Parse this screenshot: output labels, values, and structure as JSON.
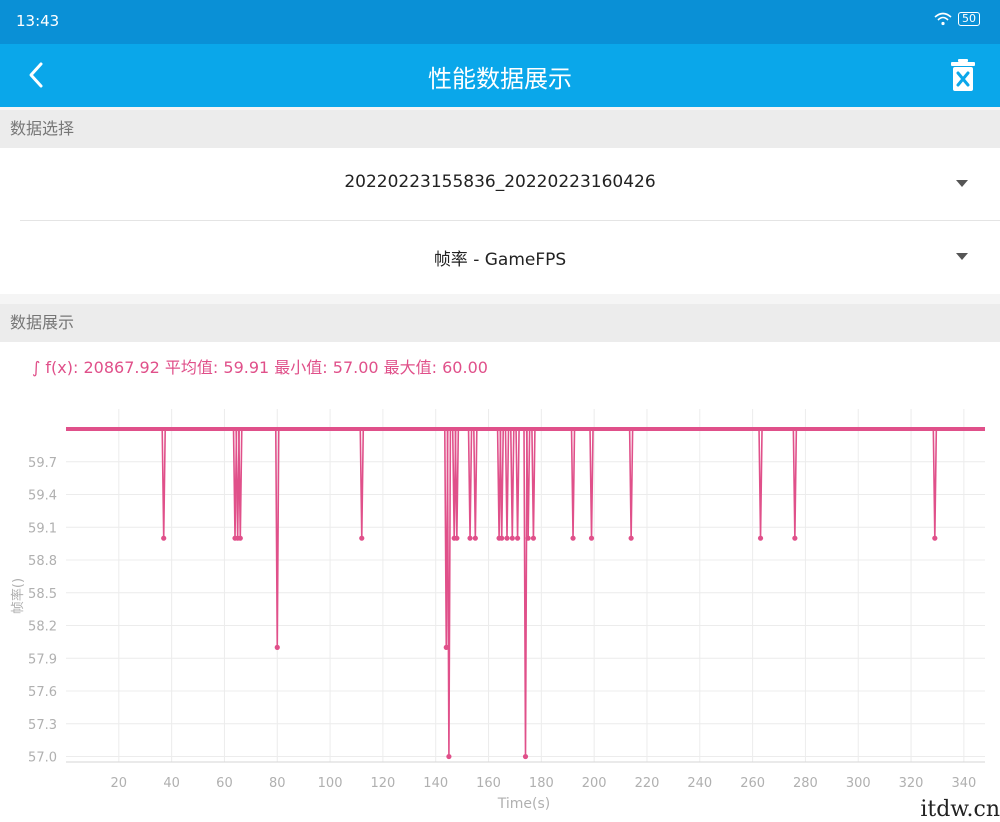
{
  "status_bar": {
    "time": "13:43",
    "battery": "50"
  },
  "header": {
    "title": "性能数据展示"
  },
  "sections": {
    "data_select": "数据选择",
    "data_display": "数据展示"
  },
  "selectors": {
    "session": "20220223155836_20220223160426",
    "metric": "帧率 - GameFPS"
  },
  "stats_line": "∫ f(x): 20867.92 平均值: 59.91 最小值: 57.00 最大值: 60.00",
  "watermark": "itdw.cn",
  "colors": {
    "accent": "#0aa7ea",
    "status_bar": "#0a90d6",
    "series": "#e0508a"
  },
  "chart_data": {
    "type": "line",
    "xlabel": "Time(s)",
    "ylabel": "帧率()",
    "xlim": [
      0,
      348
    ],
    "ylim": [
      56.95,
      60.0
    ],
    "x_ticks": [
      20,
      40,
      60,
      80,
      100,
      120,
      140,
      160,
      180,
      200,
      220,
      240,
      260,
      280,
      300,
      320,
      340
    ],
    "y_ticks": [
      57.0,
      57.3,
      57.6,
      57.9,
      58.2,
      58.5,
      58.8,
      59.1,
      59.4,
      59.7
    ],
    "baseline_value": 60.0,
    "baseline_range": [
      0,
      348
    ],
    "drops": [
      {
        "x": 37,
        "value": 59
      },
      {
        "x": 64,
        "value": 59
      },
      {
        "x": 65,
        "value": 59
      },
      {
        "x": 66,
        "value": 59
      },
      {
        "x": 80,
        "value": 58
      },
      {
        "x": 112,
        "value": 59
      },
      {
        "x": 144,
        "value": 58
      },
      {
        "x": 145,
        "value": 57
      },
      {
        "x": 147,
        "value": 59
      },
      {
        "x": 148,
        "value": 59
      },
      {
        "x": 153,
        "value": 59
      },
      {
        "x": 155,
        "value": 59
      },
      {
        "x": 164,
        "value": 59
      },
      {
        "x": 165,
        "value": 59
      },
      {
        "x": 167,
        "value": 59
      },
      {
        "x": 169,
        "value": 59
      },
      {
        "x": 171,
        "value": 59
      },
      {
        "x": 174,
        "value": 57
      },
      {
        "x": 175,
        "value": 59
      },
      {
        "x": 177,
        "value": 59
      },
      {
        "x": 192,
        "value": 59
      },
      {
        "x": 199,
        "value": 59
      },
      {
        "x": 214,
        "value": 59
      },
      {
        "x": 263,
        "value": 59
      },
      {
        "x": 276,
        "value": 59
      },
      {
        "x": 329,
        "value": 59
      }
    ]
  }
}
